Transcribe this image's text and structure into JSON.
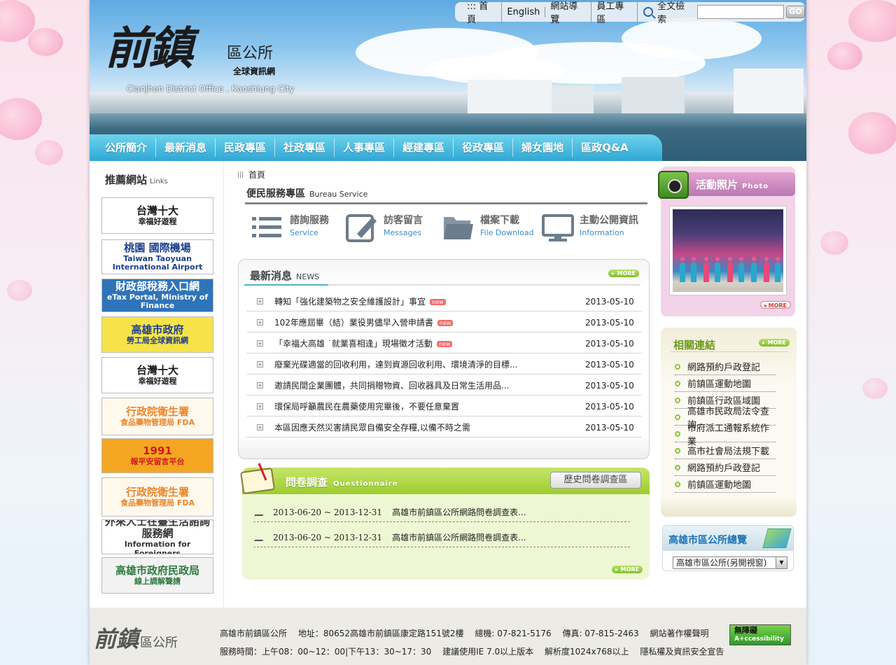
{
  "topbar": {
    "links": [
      "::: 首頁",
      "English",
      "網站導覽",
      "員工專區"
    ],
    "search_label": "全文檢索",
    "search_value": "",
    "go_label": "GO"
  },
  "logo": {
    "main": "前鎮",
    "side": "區公所",
    "sub": "全球資訊網",
    "en": "Cianjhen District Office , Kaoshiung City"
  },
  "nav": [
    "公所簡介",
    "最新消息",
    "民政專區",
    "社政專區",
    "人事專區",
    "經建專區",
    "役政專區",
    "婦女園地",
    "區政Q&A"
  ],
  "sidebar": {
    "title": "推薦網站",
    "title_en": "Links",
    "banners": [
      {
        "line1": "台灣十大",
        "line2": "幸福好遊程",
        "bg": "#ffffff",
        "fg": "#1a1a1a"
      },
      {
        "line1": "桃園 國際機場",
        "line2": "Taiwan Taoyuan International Airport",
        "bg": "#ffffff",
        "fg": "#1c3f8f"
      },
      {
        "line1": "財政部稅務入口網",
        "line2": "eTax Portal, Ministry of Finance",
        "bg": "#2f74b8",
        "fg": "#ffffff"
      },
      {
        "line1": "高雄市政府",
        "line2": "勞工局全球資訊網",
        "bg": "#f6e34a",
        "fg": "#1c3f8f"
      },
      {
        "line1": "台灣十大",
        "line2": "幸福好遊程",
        "bg": "#ffffff",
        "fg": "#1a1a1a"
      },
      {
        "line1": "行政院衛生署",
        "line2": "食品藥物管理局 FDA",
        "bg": "#fff8ec",
        "fg": "#e9862a"
      },
      {
        "line1": "1991",
        "line2": "報平安留言平台",
        "bg": "#f4a623",
        "fg": "#d0181f"
      },
      {
        "line1": "行政院衛生署",
        "line2": "食品藥物管理局 FDA",
        "bg": "#fff8ec",
        "fg": "#e9862a"
      },
      {
        "line1": "外來人士在臺生活諮詢服務網",
        "line2": "Information for Foreigners",
        "bg": "#ffffff",
        "fg": "#333333"
      },
      {
        "line1": "高雄市政府民政局",
        "line2": "線上調解聲請",
        "bg": "#f2f2f2",
        "fg": "#2c7a3e"
      }
    ]
  },
  "breadcrumb": "首頁",
  "services": {
    "title": "便民服務專區",
    "title_en": "Bureau Service",
    "items": [
      {
        "zh": "諮詢服務",
        "en": "Service",
        "icon": "list-icon"
      },
      {
        "zh": "訪客留言",
        "en": "Messages",
        "icon": "pencil-icon"
      },
      {
        "zh": "檔案下載",
        "en": "File Download",
        "icon": "folder-icon"
      },
      {
        "zh": "主動公開資訊",
        "en": "Information",
        "icon": "monitor-icon"
      }
    ]
  },
  "news": {
    "title": "最新消息",
    "title_en": "NEWS",
    "more": "MORE",
    "new_badge": "new",
    "items": [
      {
        "text": "轉知「強化建築物之安全維護設計」事宜",
        "date": "2013-05-10",
        "is_new": true
      },
      {
        "text": "102年應屆畢（結）業役男儘早入營申請書",
        "date": "2013-05-10",
        "is_new": true
      },
      {
        "text": "「幸福大高雄 ˙就業喜相逢」現場徵才活動",
        "date": "2013-05-10",
        "is_new": true
      },
      {
        "text": "廢棄光碟適當的回收利用，達到資源回收利用、環境清淨的目標...",
        "date": "2013-05-10",
        "is_new": false
      },
      {
        "text": "邀請民間企業團體，共同捐贈物資、回收器具及日常生活用品...",
        "date": "2013-05-10",
        "is_new": false
      },
      {
        "text": "環保局呼籲農民在農藥使用完畢後，不要任意棄置",
        "date": "2013-05-10",
        "is_new": false
      },
      {
        "text": "本區因應天然災害請民眾自備安全存糧,以備不時之需",
        "date": "2013-05-10",
        "is_new": false
      }
    ]
  },
  "survey": {
    "title": "問卷調查",
    "title_en": "Questionnaire",
    "history": "歷史問卷調查區",
    "more": "MORE",
    "items": [
      {
        "period": "2013-06-20 ~ 2013-12-31",
        "text": "高雄市前鎮區公所網路問卷調查表..."
      },
      {
        "period": "2013-06-20 ~ 2013-12-31",
        "text": "高雄市前鎮區公所網路問卷調查表..."
      }
    ]
  },
  "photo": {
    "title": "活動照片",
    "title_en": "Photo",
    "more": "MORE"
  },
  "related": {
    "title": "相關連結",
    "more": "MORE",
    "items": [
      "網路預約戶政登記",
      "前鎮區運動地圖",
      "前鎮區行政區域圖",
      "高雄市民政局法令查詢",
      "市府派工通報系統作業",
      "高市社會局法規下載",
      "網路預約戶政登記",
      "前鎮區運動地圖"
    ]
  },
  "district": {
    "title": "高雄市區公所總覽",
    "selected": "高雄市區公所(另開視窗)"
  },
  "footer": {
    "logo": "前鎮",
    "logo_side": "區公所",
    "line1": [
      "高雄市前鎮區公所",
      "地址：80652高雄市前鎮區康定路151號2樓",
      "總機: 07-821-5176",
      "傳真: 07-815-2463",
      "網站著作權聲明"
    ],
    "line2": [
      "服務時間：上午08：00~12：00|下午13：30~17：30",
      "建議使用IE 7.0以上版本",
      "解析度1024x768以上",
      "隱私權及資訊安全宣告"
    ],
    "access_main": "無障礙",
    "access_sub": "A+ccessibility"
  }
}
